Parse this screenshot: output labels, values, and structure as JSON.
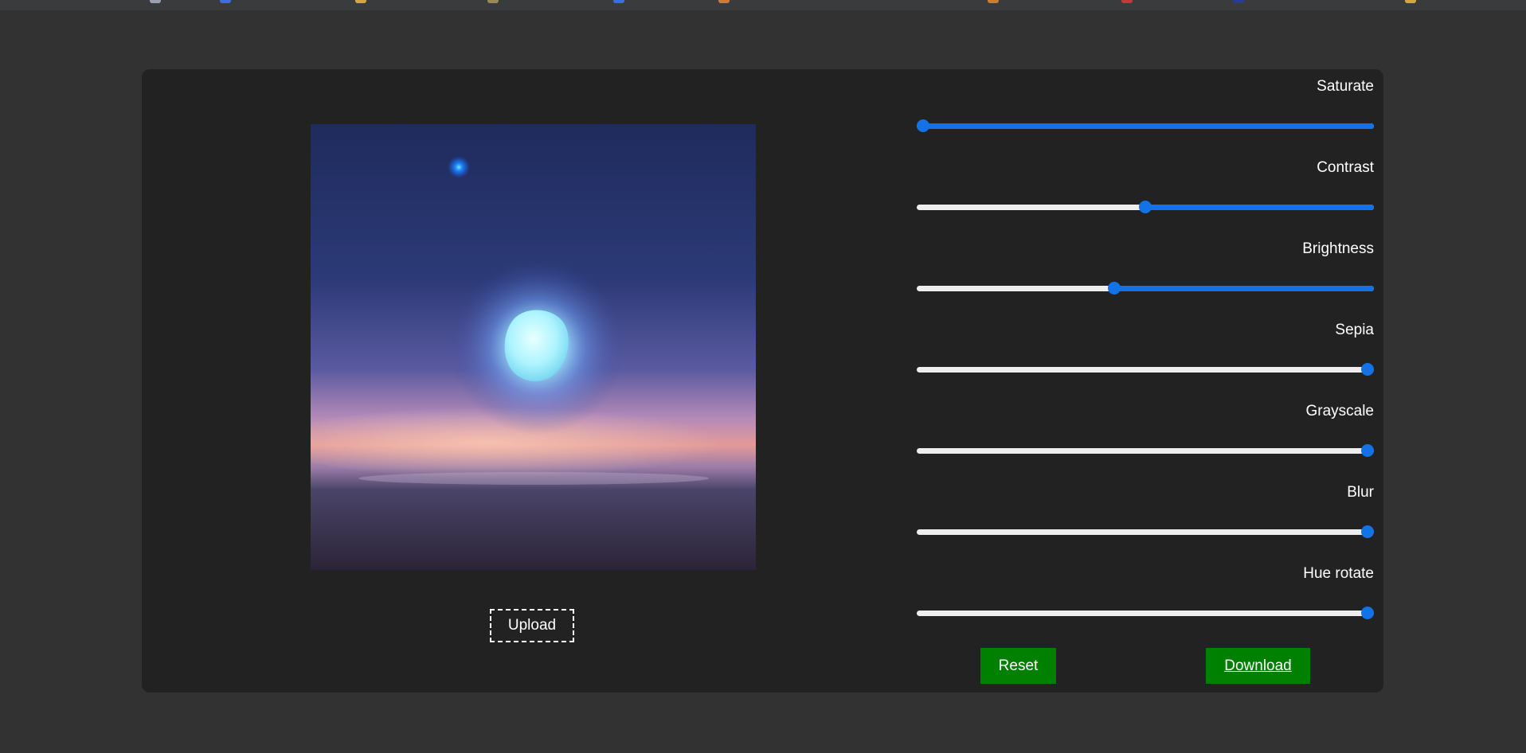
{
  "colors": {
    "page_bg": "#323232",
    "panel_bg": "#222222",
    "accent": "#1372e6",
    "track": "#eeeeee",
    "button_bg": "#008000"
  },
  "upload": {
    "label": "Upload"
  },
  "controls": [
    {
      "key": "saturate",
      "label": "Saturate",
      "value_fraction": 0.0
    },
    {
      "key": "contrast",
      "label": "Contrast",
      "value_fraction": 0.5
    },
    {
      "key": "brightness",
      "label": "Brightness",
      "value_fraction": 0.43
    },
    {
      "key": "sepia",
      "label": "Sepia",
      "value_fraction": 1.0
    },
    {
      "key": "grayscale",
      "label": "Grayscale",
      "value_fraction": 1.0
    },
    {
      "key": "blur",
      "label": "Blur",
      "value_fraction": 1.0
    },
    {
      "key": "hue_rotate",
      "label": "Hue rotate",
      "value_fraction": 1.0
    }
  ],
  "actions": {
    "reset_label": "Reset",
    "download_label": "Download"
  },
  "preview": {
    "alt": "night sky with glowing moon over horizon"
  }
}
